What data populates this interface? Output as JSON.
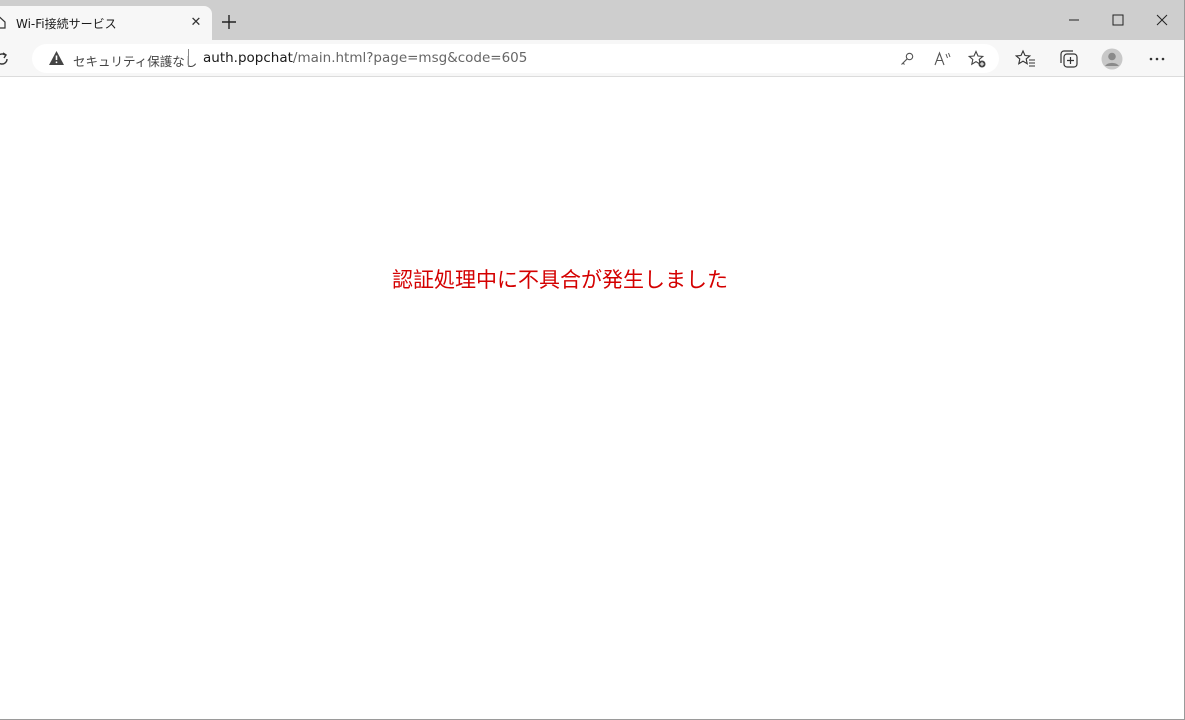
{
  "browser": {
    "tab": {
      "title": "Wi-Fi接続サービス",
      "close_glyph": "✕",
      "icon": "page-icon"
    },
    "new_tab_icon": "plus-icon",
    "window_controls": [
      "minimize-icon",
      "maximize-icon",
      "close-icon"
    ],
    "address_bar": {
      "security_label": "セキュリティ保護なし",
      "security_icon": "warning-icon",
      "url_host": "auth.popchat",
      "url_rest": "/main.html?page=msg&code=605"
    },
    "omnibox_icons": [
      "key-icon",
      "read-aloud-icon",
      "add-favorite-icon"
    ],
    "toolbar_icons": [
      "favorites-icon",
      "collections-icon",
      "profile-icon",
      "more-icon"
    ]
  },
  "page": {
    "message": "認証処理中に不具合が発生しました",
    "message_color": "#d40000"
  }
}
